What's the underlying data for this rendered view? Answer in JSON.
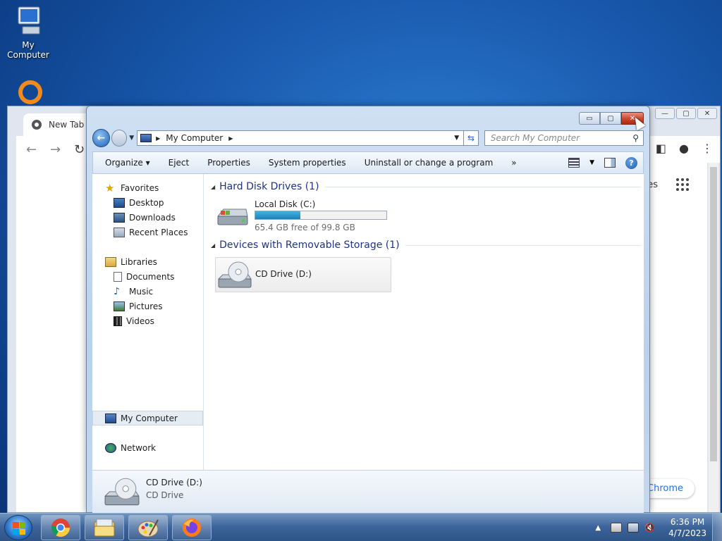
{
  "desktop": {
    "icons": [
      {
        "label": "My Computer",
        "icon": "my-computer-icon"
      }
    ]
  },
  "chrome": {
    "tab_title": "New Tab",
    "partial_text": "es",
    "pill_text": "Chrome"
  },
  "explorer": {
    "window_controls": {
      "minimize": "▭",
      "maximize": "▢",
      "close": "✕"
    },
    "address": {
      "segment": "My Computer"
    },
    "search": {
      "placeholder": "Search My Computer"
    },
    "commands": [
      "Organize ▾",
      "Eject",
      "Properties",
      "System properties",
      "Uninstall or change a program",
      "»"
    ],
    "nav": {
      "favorites": "Favorites",
      "favorites_items": [
        "Desktop",
        "Downloads",
        "Recent Places"
      ],
      "libraries": "Libraries",
      "libraries_items": [
        "Documents",
        "Music",
        "Pictures",
        "Videos"
      ],
      "computer": "My Computer",
      "network": "Network"
    },
    "groups": {
      "hdd_title": "Hard Disk Drives (1)",
      "removable_title": "Devices with Removable Storage (1)"
    },
    "drive_c": {
      "name": "Local Disk (C:)",
      "free_text": "65.4 GB free of 99.8 GB",
      "used_fraction": 0.345
    },
    "drive_d": {
      "name": "CD Drive (D:)"
    },
    "details": {
      "title": "CD Drive (D:)",
      "subtitle": "CD Drive"
    }
  },
  "taskbar": {
    "apps": [
      "chrome-icon",
      "explorer-icon",
      "paint-icon",
      "firefox-icon"
    ],
    "clock": {
      "time": "6:36 PM",
      "date": "4/7/2023"
    }
  }
}
